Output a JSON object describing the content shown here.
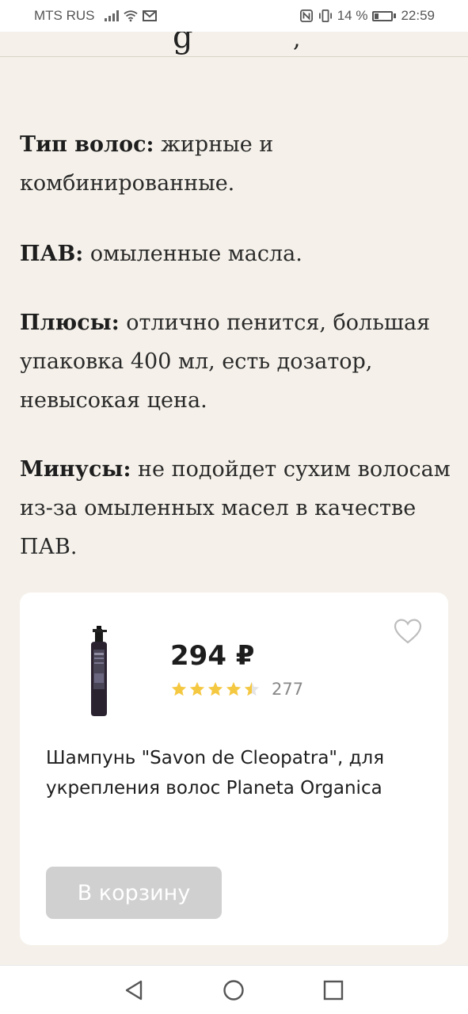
{
  "status_bar": {
    "carrier": "MTS RUS",
    "battery": "14 %",
    "time": "22:59"
  },
  "header": {
    "fragment_a": "g",
    "fragment_b": ","
  },
  "article": {
    "paragraphs": [
      {
        "label": "Тип волос:",
        "text": " жирные и комбинированные."
      },
      {
        "label": "ПАВ:",
        "text": " омыленные масла."
      },
      {
        "label": "Плюсы:",
        "text": " отлично пенится, большая упаковка 400 мл, есть дозатор, невысокая цена."
      },
      {
        "label": "Минусы:",
        "text": " не подойдет сухим волосам из-за омыленных масел в качестве ПАВ."
      }
    ]
  },
  "product": {
    "price": "294 ₽",
    "rating": 4.5,
    "reviews": "277",
    "name": "Шампунь \"Savon de Cleopatra\", для укрепления волос Planeta Organica",
    "cart_label": "В корзину",
    "star_color": "#f5c842"
  },
  "icons": {
    "favorite": "heart-outline-icon",
    "nav": [
      "back-triangle-icon",
      "home-circle-icon",
      "recents-square-icon"
    ]
  }
}
